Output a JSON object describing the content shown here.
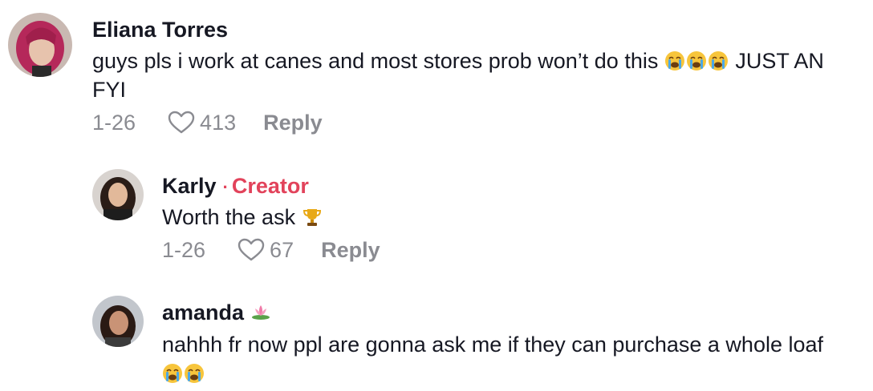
{
  "comments": [
    {
      "username": "Eliana Torres",
      "text": "guys pls i work at canes and most stores prob won’t do this",
      "emoji_after_text": [
        "loudly-crying-face",
        "loudly-crying-face",
        "loudly-crying-face"
      ],
      "text_tail": "JUST AN FYI",
      "date": "1-26",
      "likes": "413",
      "reply_label": "Reply"
    }
  ],
  "replies": [
    {
      "username": "Karly",
      "creator_separator": "·",
      "creator_label": "Creator",
      "text": "Worth the ask",
      "emoji_after_text": [
        "trophy"
      ],
      "date": "1-26",
      "likes": "67",
      "reply_label": "Reply"
    },
    {
      "username": "amanda",
      "username_emoji": "lotus",
      "text": "nahhh fr now ppl are gonna ask me if they can purchase a whole loaf",
      "emoji_after_text": [
        "loudly-crying-face",
        "loudly-crying-face"
      ]
    }
  ],
  "colors": {
    "creator_accent": "#e2435b",
    "meta_gray": "#8a8b91",
    "text_dark": "#161823"
  }
}
